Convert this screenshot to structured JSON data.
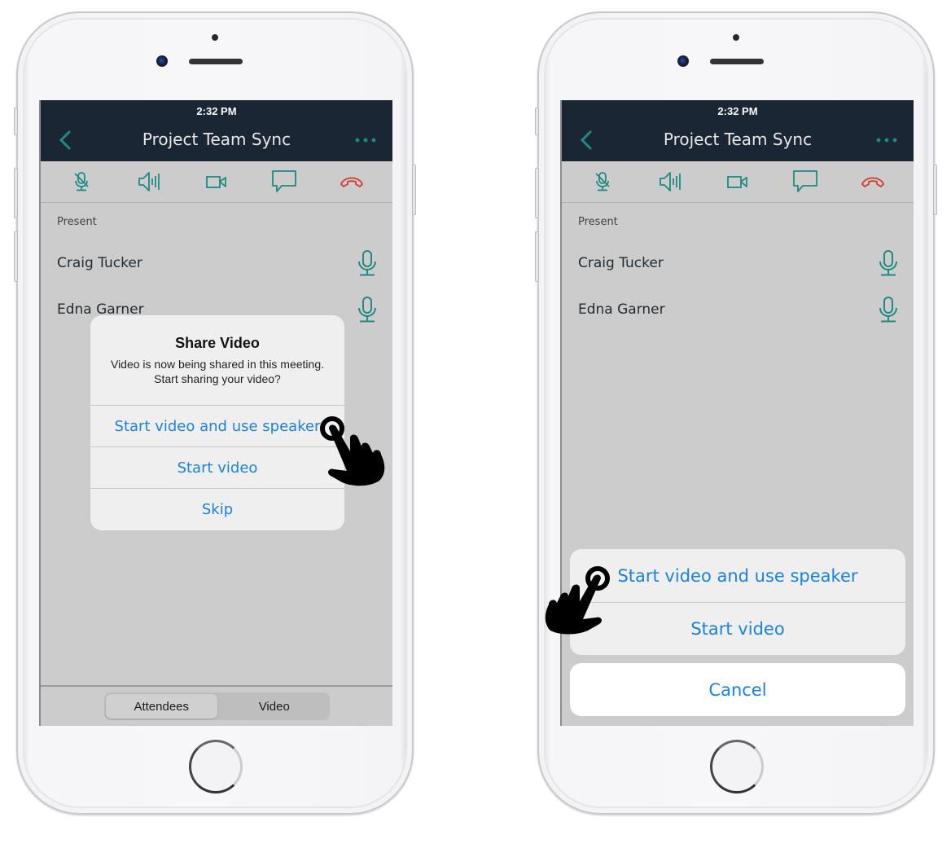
{
  "colors": {
    "navbar_bg": "#1b2634",
    "accent_teal": "#1e8a82",
    "hangup_red": "#d23b2a",
    "link_blue": "#1a82e2",
    "screen_bg": "#cccccc"
  },
  "screens": [
    {
      "id": "left",
      "status_time": "2:32 PM",
      "nav": {
        "title": "Project Team Sync",
        "back_icon": "chevron-left-icon",
        "more_icon": "more-horizontal-icon"
      },
      "toolbar": [
        {
          "icon": "mic-muted-icon",
          "label": "Mute"
        },
        {
          "icon": "speaker-icon",
          "label": "Speaker"
        },
        {
          "icon": "video-camera-icon",
          "label": "Video"
        },
        {
          "icon": "chat-icon",
          "label": "Chat"
        },
        {
          "icon": "hang-up-icon",
          "label": "Leave"
        }
      ],
      "section_label": "Present",
      "attendees": [
        {
          "name": "Craig Tucker",
          "icon": "microphone-icon"
        },
        {
          "name": "Edna Garner",
          "icon": "microphone-icon"
        }
      ],
      "segmented": {
        "items": [
          "Attendees",
          "Video"
        ],
        "selected": "Attendees"
      },
      "alert": {
        "title": "Share Video",
        "message": "Video is now being shared in this meeting. Start sharing your video?",
        "buttons": [
          "Start video and use speaker",
          "Start video",
          "Skip"
        ]
      },
      "pointer": {
        "icon": "tap-hand-icon",
        "target": "Start video and use speaker"
      }
    },
    {
      "id": "right",
      "status_time": "2:32 PM",
      "nav": {
        "title": "Project Team Sync",
        "back_icon": "chevron-left-icon",
        "more_icon": "more-horizontal-icon"
      },
      "toolbar": [
        {
          "icon": "mic-muted-icon",
          "label": "Mute"
        },
        {
          "icon": "speaker-icon",
          "label": "Speaker"
        },
        {
          "icon": "video-camera-icon",
          "label": "Video"
        },
        {
          "icon": "chat-icon",
          "label": "Chat"
        },
        {
          "icon": "hang-up-icon",
          "label": "Leave"
        }
      ],
      "section_label": "Present",
      "attendees": [
        {
          "name": "Craig Tucker",
          "icon": "microphone-icon"
        },
        {
          "name": "Edna Garner",
          "icon": "microphone-icon"
        }
      ],
      "action_sheet": {
        "buttons": [
          "Start video and use speaker",
          "Start video"
        ],
        "cancel": "Cancel"
      },
      "pointer": {
        "icon": "tap-hand-icon",
        "target": "Start video and use speaker"
      }
    }
  ]
}
